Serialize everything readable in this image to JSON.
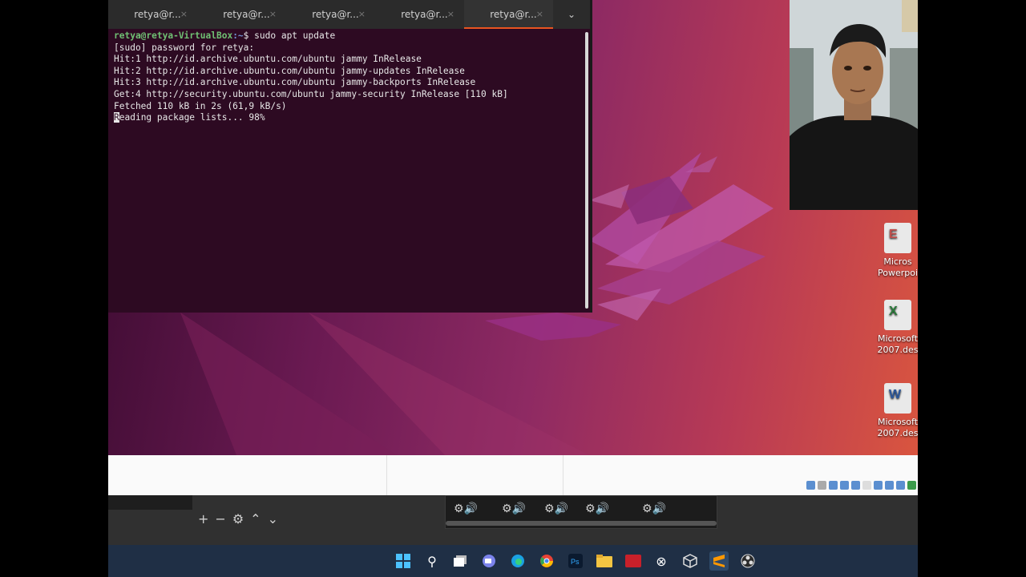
{
  "terminal": {
    "tabs": [
      {
        "label": "retya@r...",
        "close": "×"
      },
      {
        "label": "retya@r...",
        "close": "×"
      },
      {
        "label": "retya@r...",
        "close": "×"
      },
      {
        "label": "retya@r...",
        "close": "×"
      },
      {
        "label": "retya@r...",
        "close": "×"
      }
    ],
    "tab_menu": "⌄",
    "prompt_user": "retya@retya-VirtualBox",
    "prompt_path": ":~",
    "prompt_symbol": "$ ",
    "command": "sudo apt update",
    "lines": [
      "[sudo] password for retya:",
      "Hit:1 http://id.archive.ubuntu.com/ubuntu jammy InRelease",
      "Hit:2 http://id.archive.ubuntu.com/ubuntu jammy-updates InRelease",
      "Hit:3 http://id.archive.ubuntu.com/ubuntu jammy-backports InRelease",
      "Get:4 http://security.ubuntu.com/ubuntu jammy-security InRelease [110 kB]",
      "Fetched 110 kB in 2s (61,9 kB/s)"
    ],
    "last_line_cursor": "R",
    "last_line_rest": "eading package lists... 98%"
  },
  "desktop_icons": [
    {
      "label_line1": "Micros",
      "label_line2": "Powerpoi",
      "glyph": "E"
    },
    {
      "label_line1": "Microsoft",
      "label_line2": "2007.des",
      "glyph": "X"
    },
    {
      "label_line1": "Microsoft",
      "label_line2": "2007.des",
      "glyph": "W"
    }
  ],
  "obs": {
    "controls": [
      "+",
      "−",
      "⚙",
      "⌃",
      "⌄"
    ],
    "channel_glyph": "⚙🔊"
  },
  "taskbar": {
    "icons": [
      "windows-start",
      "search",
      "task-view",
      "chat",
      "edge",
      "chrome",
      "photoshop",
      "file-explorer",
      "app-red",
      "xbox",
      "virtualbox",
      "sublime",
      "obs"
    ],
    "glyphs": {
      "search": "⚲",
      "xbox": "⊗"
    }
  },
  "colors": {
    "terminal_bg": "#2d0a22",
    "tab_accent": "#e95420",
    "taskbar_bg": "#1f2f45"
  }
}
